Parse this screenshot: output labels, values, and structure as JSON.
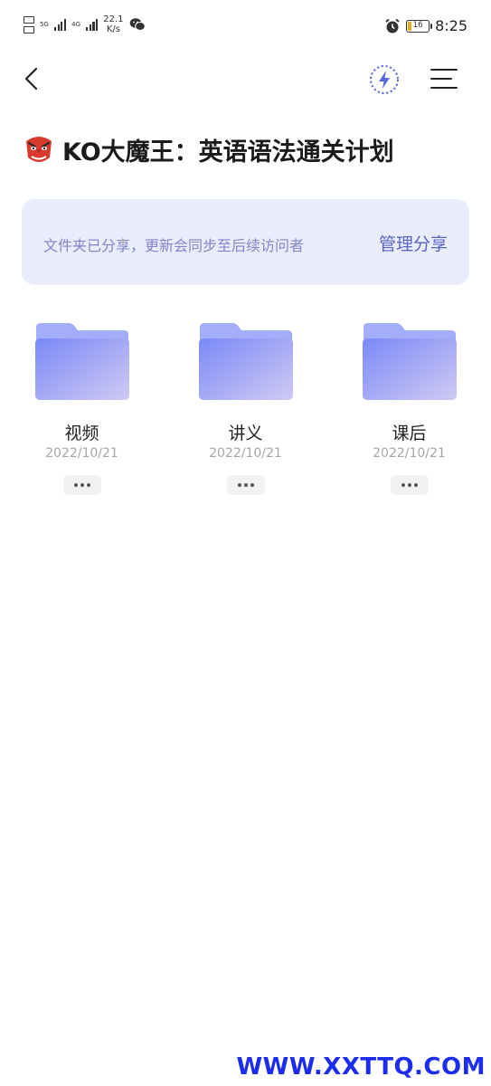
{
  "status_bar": {
    "net_type_1": "5G",
    "net_type_2": "4G",
    "speed_value": "22.1",
    "speed_unit": "K/s",
    "battery_level": "16",
    "time": "8:25"
  },
  "header": {
    "title": "KO大魔王：英语语法通关计划",
    "title_icon": "tengu-mask-emoji"
  },
  "share_banner": {
    "text": "文件夹已分享，更新会同步至后续访问者",
    "action_label": "管理分享"
  },
  "folders": [
    {
      "name": "视频",
      "date": "2022/10/21"
    },
    {
      "name": "讲义",
      "date": "2022/10/21"
    },
    {
      "name": "课后",
      "date": "2022/10/21"
    }
  ],
  "watermark": "WWW.XXTTQ.COM",
  "colors": {
    "banner_bg": "#e9edfd",
    "banner_text": "#7d87c9",
    "accent": "#5865c4",
    "folder_start": "#7d8cf8",
    "folder_end": "#cdc7f3"
  }
}
